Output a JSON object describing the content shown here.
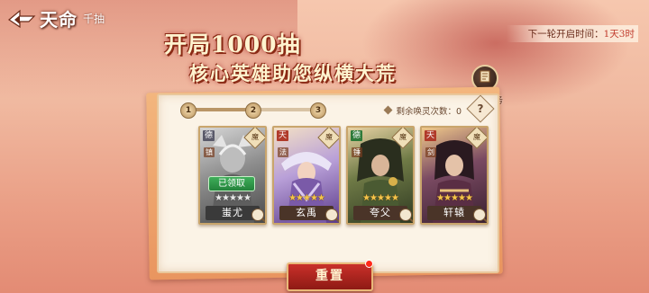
{
  "header": {
    "logo_title": "天命",
    "logo_subtitle": "千抽",
    "headline_line1": "开局1000抽",
    "headline_line2": "核心英雄助您纵横大荒",
    "next_open_label": "下一轮开启时间：",
    "next_open_value": "1天3时"
  },
  "task_button": {
    "label": "千抽任务",
    "icon": "scroll-task-icon"
  },
  "panel": {
    "progress_nodes": [
      "1",
      "2",
      "3"
    ],
    "progress_fraction": 0.5,
    "remaining_label": "剩余唤灵次数：",
    "remaining_value": "0",
    "help_label": "?"
  },
  "cards": [
    {
      "name": "蚩尤",
      "faction": "德",
      "sub": "镇",
      "role": "魔",
      "stars": "★★★★★",
      "claimed": true,
      "claimed_label": "已领取"
    },
    {
      "name": "玄禹",
      "faction": "天",
      "sub": "法",
      "role": "魔",
      "stars": "★★★★★",
      "claimed": false
    },
    {
      "name": "夸父",
      "faction": "德",
      "sub": "锤",
      "role": "魔",
      "stars": "★★★★★",
      "claimed": false
    },
    {
      "name": "轩辕",
      "faction": "天",
      "sub": "剑",
      "role": "魔",
      "stars": "★★★★★",
      "claimed": false
    }
  ],
  "reset_button": {
    "label": "重置"
  },
  "colors": {
    "accent_red": "#c9302a",
    "panel_bg": "#fbf3e6",
    "star_gold": "#f5c54a"
  }
}
